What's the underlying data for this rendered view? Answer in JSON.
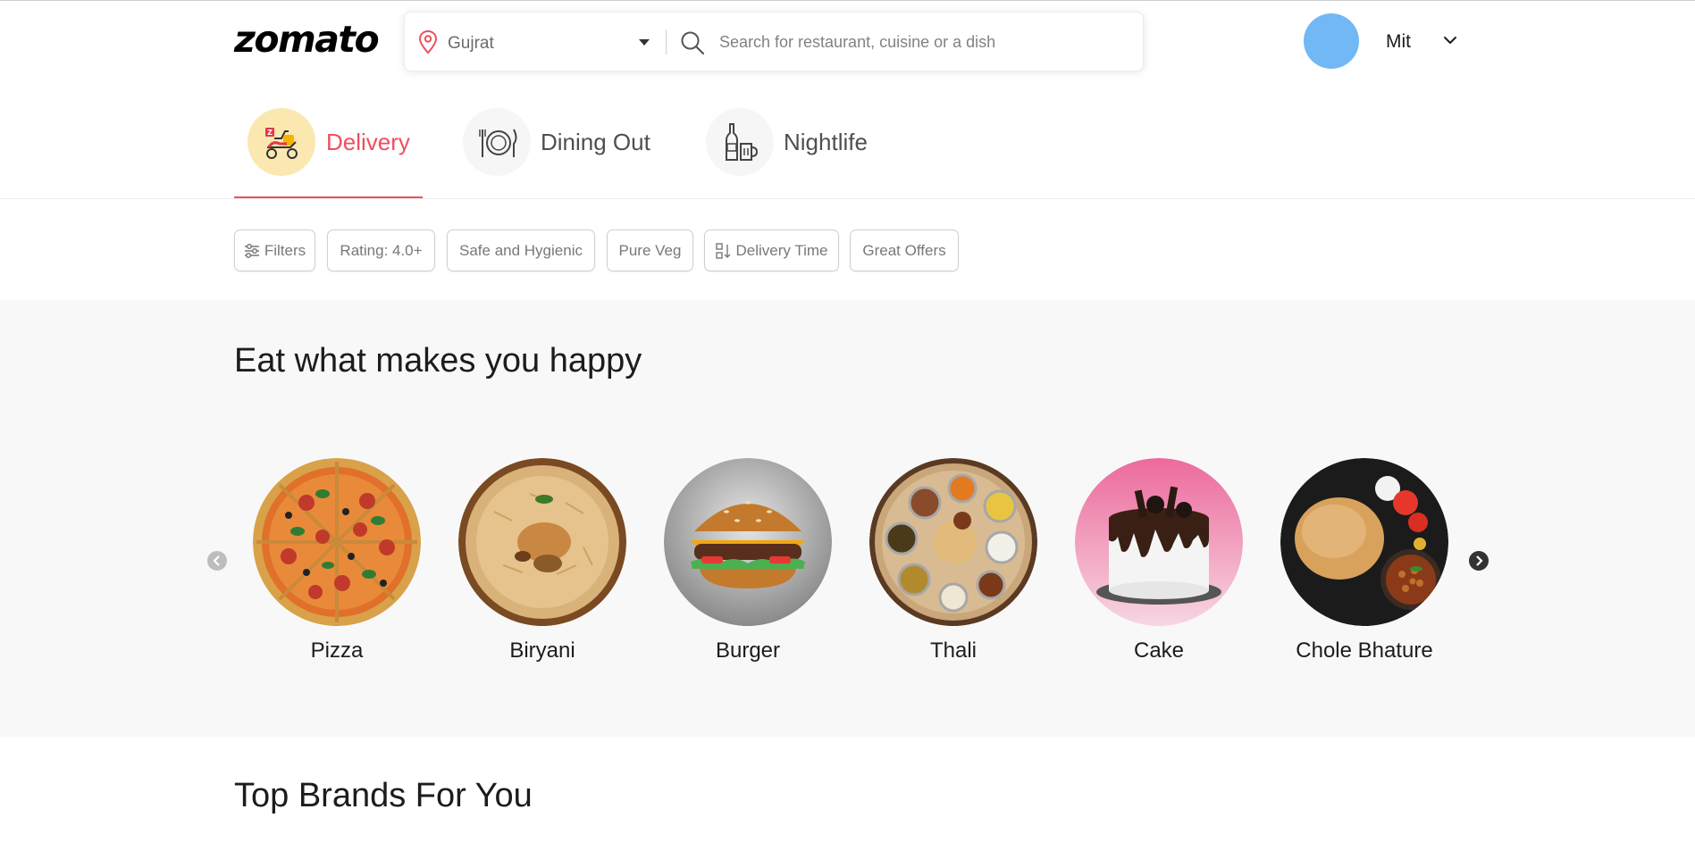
{
  "header": {
    "logo": "zomato",
    "location": "Gujrat",
    "search_placeholder": "Search for restaurant, cuisine or a dish",
    "username": "Mit",
    "avatar_color": "#71b8f5"
  },
  "tabs": [
    {
      "label": "Delivery",
      "icon": "scooter-delivery-icon",
      "active": true
    },
    {
      "label": "Dining Out",
      "icon": "plate-cutlery-icon",
      "active": false
    },
    {
      "label": "Nightlife",
      "icon": "bottle-glass-icon",
      "active": false
    }
  ],
  "filters": [
    {
      "label": "Filters",
      "icon": "sliders-icon"
    },
    {
      "label": "Rating: 4.0+"
    },
    {
      "label": "Safe and Hygienic"
    },
    {
      "label": "Pure Veg"
    },
    {
      "label": "Delivery Time",
      "icon": "sort-icon"
    },
    {
      "label": "Great Offers"
    }
  ],
  "sections": {
    "eat_heading": "Eat what makes you happy",
    "brands_heading": "Top Brands For You"
  },
  "foods": [
    {
      "label": "Pizza"
    },
    {
      "label": "Biryani"
    },
    {
      "label": "Burger"
    },
    {
      "label": "Thali"
    },
    {
      "label": "Cake"
    },
    {
      "label": "Chole Bhature"
    }
  ],
  "colors": {
    "accent": "#ef4f5f",
    "active_tab_bg": "#fbe8b1",
    "section_bg": "#f8f8f8"
  }
}
